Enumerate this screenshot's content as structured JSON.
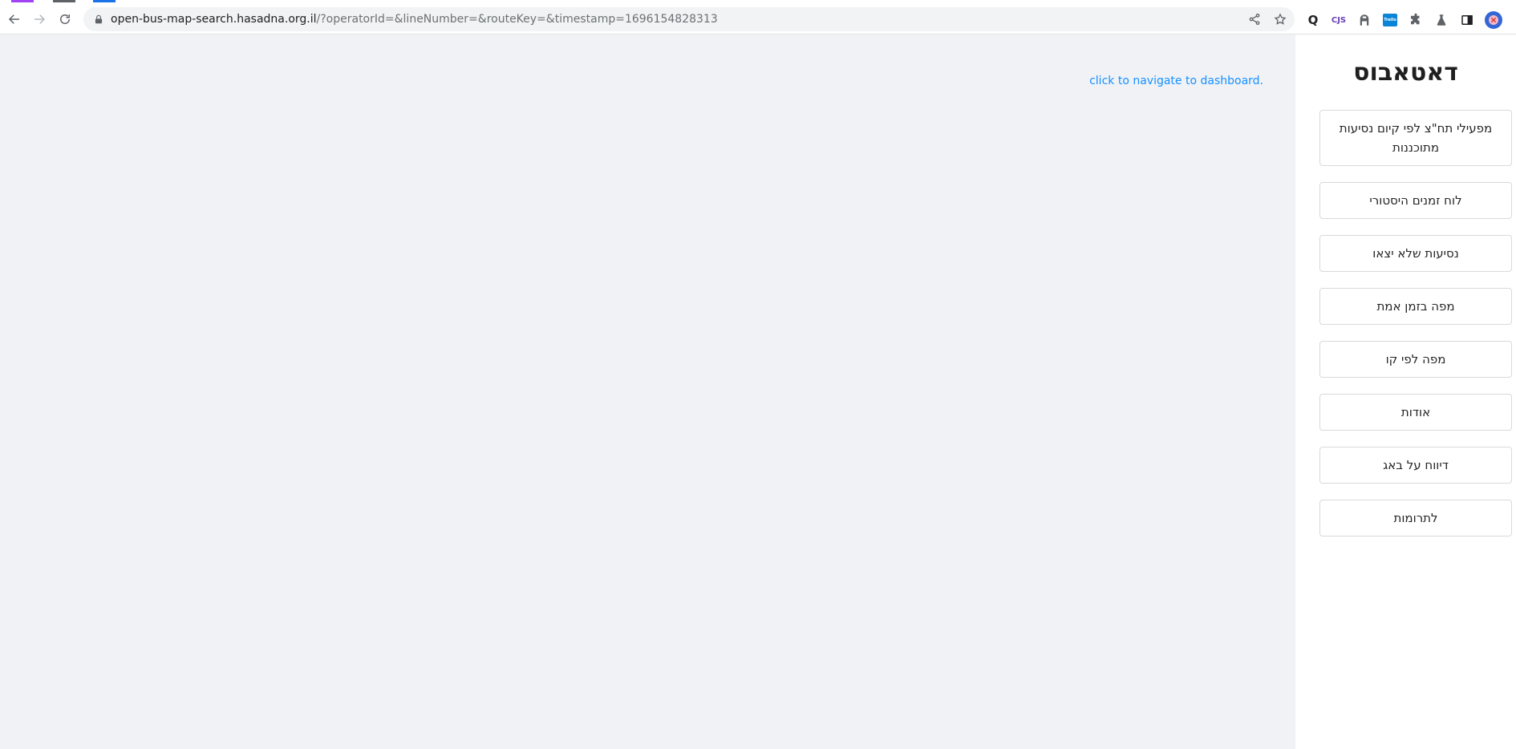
{
  "browser": {
    "url_host": "open-bus-map-search.hasadna.org.il",
    "url_path": "/?operatorId=&lineNumber=&routeKey=&timestamp=1696154828313",
    "accent_colors": [
      "#a142f4",
      "#5f6368",
      "#1a73e8"
    ],
    "extensions": [
      {
        "icon": "q-search-icon",
        "label": "Q"
      },
      {
        "icon": "cjs-icon",
        "label": "CJS"
      },
      {
        "icon": "incognito-agent-icon",
        "label": ""
      },
      {
        "icon": "trello-icon",
        "label": "Trello"
      },
      {
        "icon": "puzzle-extensions-icon",
        "label": ""
      },
      {
        "icon": "flask-labs-icon",
        "label": ""
      },
      {
        "icon": "side-panel-icon",
        "label": ""
      }
    ]
  },
  "main": {
    "dashboard_link": "click to navigate to dashboard."
  },
  "sidebar": {
    "logo": "דאטאבוס",
    "items": [
      {
        "label": "מפעילי תח\"צ לפי קיום נסיעות מתוכננות"
      },
      {
        "label": "לוח זמנים היסטורי"
      },
      {
        "label": "נסיעות שלא יצאו"
      },
      {
        "label": "מפה בזמן אמת"
      },
      {
        "label": "מפה לפי קו"
      },
      {
        "label": "אודות"
      },
      {
        "label": "דיווח על באג"
      },
      {
        "label": "לתרומות"
      }
    ]
  },
  "colors": {
    "main_bg": "#f0f2f5",
    "link": "#1890ff",
    "border": "#d9d9d9"
  }
}
